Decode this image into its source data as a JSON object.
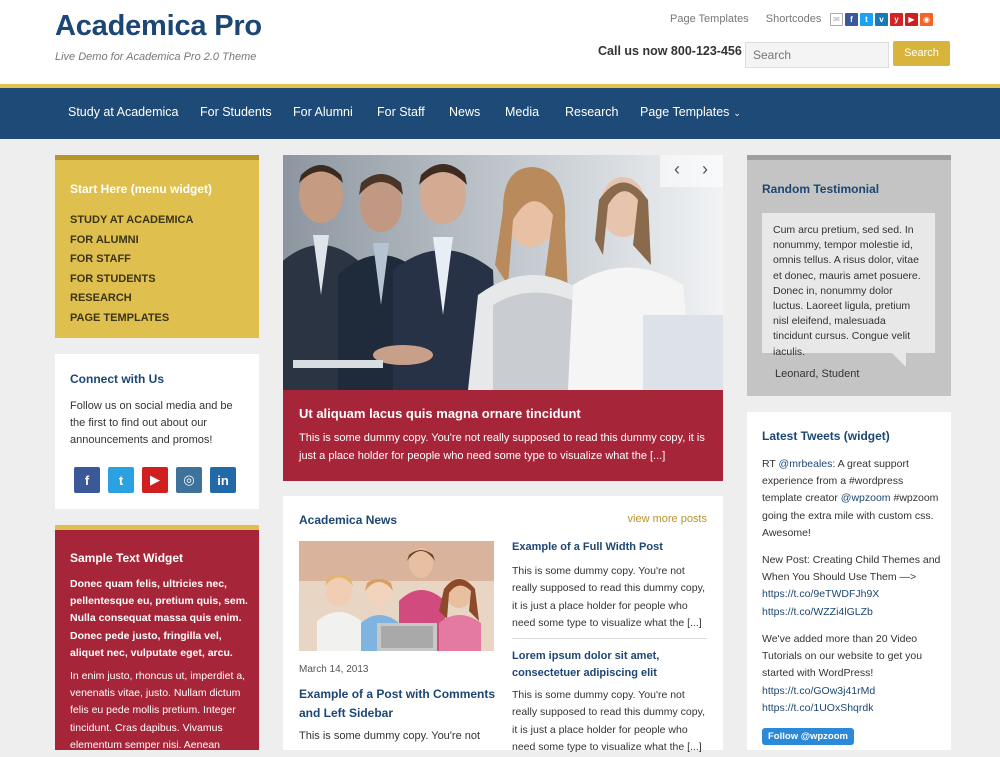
{
  "header": {
    "title": "Academica Pro",
    "tagline": "Live Demo for Academica Pro 2.0 Theme",
    "top_links": [
      "Page Templates",
      "Shortcodes"
    ],
    "call_us": "Call us now 800-123-456",
    "search_placeholder": "Search",
    "search_button": "Search",
    "social_icons": [
      "mail-icon",
      "facebook-icon",
      "twitter-icon",
      "vimeo-icon",
      "yelp-icon",
      "youtube-icon",
      "rss-icon"
    ]
  },
  "nav": {
    "items": [
      "Study at Academica",
      "For Students",
      "For Alumni",
      "For Staff",
      "News",
      "Media",
      "Research",
      "Page Templates"
    ]
  },
  "menu_widget": {
    "title": "Start Here (menu widget)",
    "items": [
      "STUDY AT ACADEMICA",
      "FOR ALUMNI",
      "FOR STAFF",
      "FOR STUDENTS",
      "RESEARCH",
      "PAGE TEMPLATES"
    ]
  },
  "connect": {
    "title": "Connect with Us",
    "text": "Follow us on social media and be the first to find out about our announcements and promos!",
    "icons": [
      "facebook-icon",
      "twitter-icon",
      "youtube-icon",
      "instagram-icon",
      "linkedin-icon"
    ]
  },
  "sample": {
    "title": "Sample Text Widget",
    "p1": "Donec quam felis, ultricies nec, pellentesque eu, pretium quis, sem. Nulla consequat massa quis enim. Donec pede justo, fringilla vel, aliquet nec, vulputate eget, arcu.",
    "p2": "In enim justo, rhoncus ut, imperdiet a, venenatis vitae, justo. Nullam dictum felis eu pede mollis pretium. Integer tincidunt. Cras dapibus. Vivamus elementum semper nisi. Aenean"
  },
  "slider": {
    "title": "Ut aliquam lacus quis magna ornare tincidunt",
    "text": "This is some dummy copy. You're not really supposed to read this dummy copy, it is just a place holder for people who need some type to visualize what the [...]",
    "prev": "‹",
    "next": "›"
  },
  "news": {
    "title": "Academica News",
    "more": "view more posts",
    "left_date": "March 14, 2013",
    "left_title": "Example of a Post with Comments and Left Sidebar",
    "left_excerpt": "This is some dummy copy. You're not",
    "r1_title": "Example of a Full Width Post",
    "r1_text": "This is some dummy copy. You're not really supposed to read this dummy copy, it is just a place holder for people who need some type to visualize what the [...]",
    "r2_title": "Lorem ipsum dolor sit amet, consectetuer adipiscing elit",
    "r2_text": "This is some dummy copy. You're not really supposed to read this dummy copy, it is just a place holder for people who need some type to visualize what the [...]"
  },
  "testimonial": {
    "title": "Random Testimonial",
    "quote": "Cum arcu pretium, sed sed. In nonummy, tempor molestie id, omnis tellus. A risus dolor, vitae et donec, mauris amet posuere. Donec in, nonummy dolor luctus. Laoreet ligula, pretium nisl eleifend, malesuada tincidunt cursus. Congue velit iaculis.",
    "author": "Leonard, Student"
  },
  "tweets": {
    "title": "Latest Tweets (widget)",
    "t1_pre": "RT ",
    "t1_handle": "@mrbeales",
    "t1_mid": ": A great support experience from a #wordpress template creator ",
    "t1_handle2": "@wpzoom",
    "t1_end": " #wpzoom going the extra mile with custom css. Awesome!",
    "t2_text": "New Post: Creating Child Themes and When You Should Use Them —>",
    "t2_link1": "https://t.co/9eTWDFJh9X",
    "t2_link2": "https://t.co/WZZi4lGLZb",
    "t3_text": "We've added more than 20 Video Tutorials on our website to get you started with WordPress!",
    "t3_link1": "https://t.co/GOw3j41rMd",
    "t3_link2": "https://t.co/1UOxShqrdk",
    "follow": "Follow @wpzoom"
  }
}
